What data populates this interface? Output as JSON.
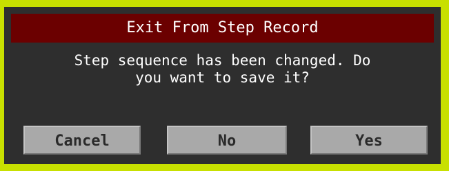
{
  "dialog": {
    "title": "Exit From Step Record",
    "message": "Step sequence has been changed. Do\nyou want to save it?",
    "buttons": {
      "cancel": "Cancel",
      "no": "No",
      "yes": "Yes"
    }
  },
  "colors": {
    "frame": "#c8e000",
    "background": "#2e2e2e",
    "titlebar": "#6b0000",
    "button": "#a9a9a9"
  }
}
